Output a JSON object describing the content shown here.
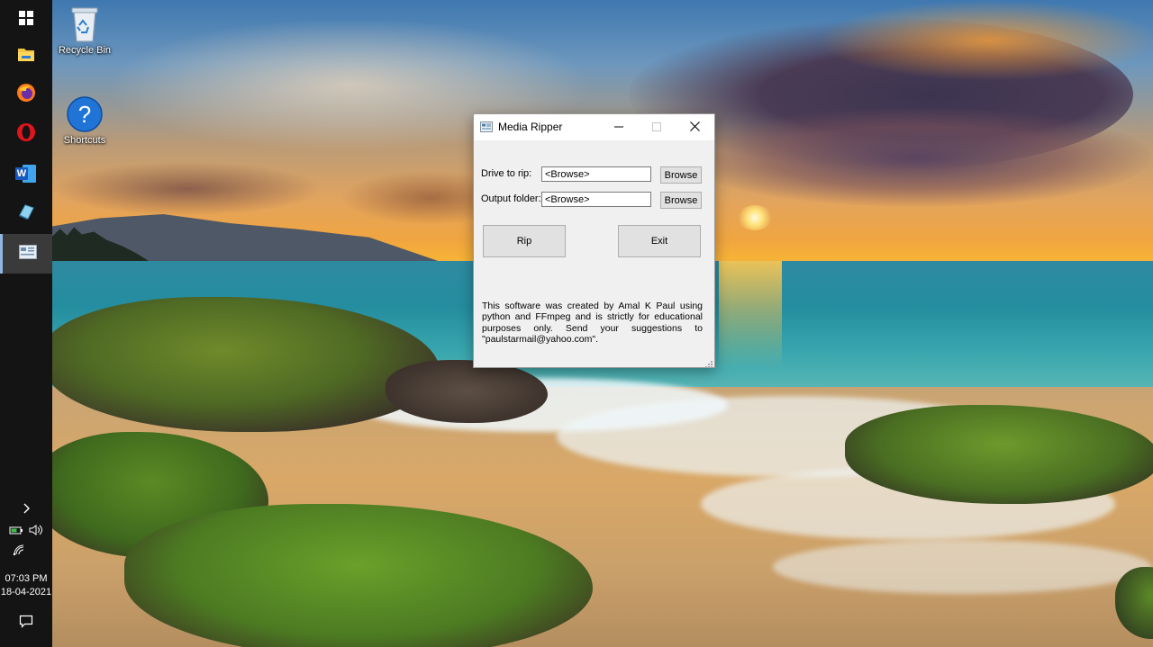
{
  "desktop": {
    "icons": [
      {
        "label": "Recycle Bin",
        "icon": "recycle-bin-icon"
      },
      {
        "label": "Shortcuts",
        "icon": "help-icon"
      }
    ]
  },
  "taskbar": {
    "buttons": [
      {
        "icon": "windows-start-icon"
      },
      {
        "icon": "file-explorer-icon"
      },
      {
        "icon": "firefox-icon"
      },
      {
        "icon": "opera-icon"
      },
      {
        "icon": "word-icon",
        "text": "W"
      },
      {
        "icon": "app-icon"
      },
      {
        "icon": "media-ripper-app-icon"
      }
    ],
    "tray": {
      "time": "07:03 PM",
      "date": "18-04-2021",
      "icons": [
        "chevron-up-icon",
        "battery-icon",
        "volume-icon",
        "wifi-icon",
        "notification-icon"
      ]
    }
  },
  "window": {
    "title": "Media Ripper",
    "drive_label": "Drive to rip:",
    "drive_value": "<Browse>",
    "output_label": "Output folder:",
    "output_value": "<Browse>",
    "browse_label": "Browse",
    "rip_label": "Rip",
    "exit_label": "Exit",
    "about_text": "This software was created by Amal K Paul using python and FFmpeg and is strictly for educational purposes only. Send your suggestions to \"paulstarmail@yahoo.com\"."
  },
  "colors": {
    "taskbar": "#141414",
    "window_bg": "#f0f0f0",
    "button_bg": "#e1e1e1",
    "accent": "#0078d7"
  }
}
